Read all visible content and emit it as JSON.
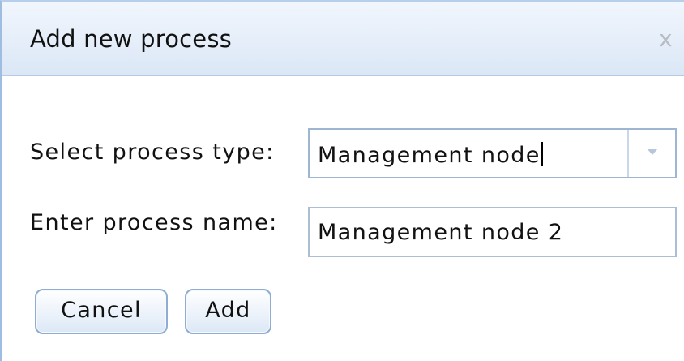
{
  "dialog": {
    "title": "Add new process",
    "close_icon": "close-icon",
    "close_glyph": "x"
  },
  "form": {
    "process_type_label": "Select process type:",
    "process_type_value": "Management node",
    "process_name_label": "Enter process name:",
    "process_name_value": "Management node 2"
  },
  "buttons": {
    "cancel_label": "Cancel",
    "add_label": "Add"
  },
  "colors": {
    "title_bar": "#dbe7f6",
    "border_accent": "#9fbde0",
    "button_border": "#8fadd2"
  }
}
